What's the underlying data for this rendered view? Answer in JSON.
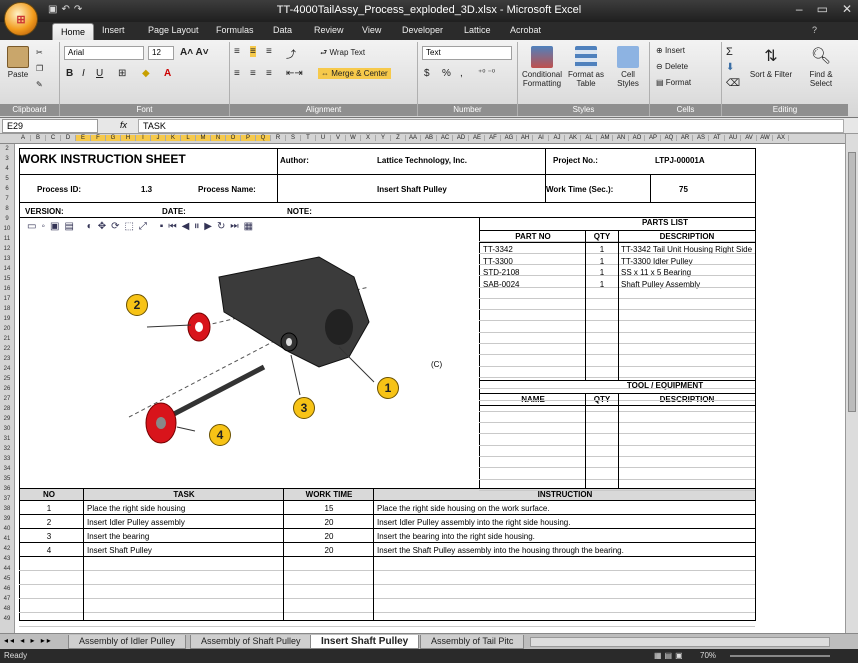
{
  "window": {
    "title": "TT-4000TailAssy_Process_exploded_3D.xlsx - Microsoft Excel"
  },
  "ribbon_tabs": [
    "Home",
    "Insert",
    "Page Layout",
    "Formulas",
    "Data",
    "Review",
    "View",
    "Developer",
    "Lattice",
    "Acrobat"
  ],
  "ribbon": {
    "paste": "Paste",
    "clipboard": "Clipboard",
    "font_name": "Arial",
    "font_size": "12",
    "font": "Font",
    "wrap_text": "Wrap Text",
    "merge_center": "Merge & Center",
    "alignment": "Alignment",
    "number_format": "Text",
    "number": "Number",
    "currency": "$",
    "percent": "%",
    "comma": ",",
    "conditional": "Conditional Formatting",
    "format_table": "Format as Table",
    "cell_styles": "Cell Styles",
    "styles": "Styles",
    "insert": "Insert",
    "delete": "Delete",
    "format": "Format",
    "cells": "Cells",
    "sort_filter": "Sort & Filter",
    "find_select": "Find & Select",
    "editing": "Editing"
  },
  "formula_bar": {
    "name_box": "E29",
    "fx": "fx",
    "value": "TASK"
  },
  "sheet": {
    "title": "WORK INSTRUCTION SHEET",
    "author_label": "Author:",
    "author": "Lattice Technology, Inc.",
    "project_label": "Project No.:",
    "project": "LTPJ-00001A",
    "process_id_label": "Process ID:",
    "process_id": "1.3",
    "process_name_label": "Process Name:",
    "process_name": "Insert Shaft Pulley",
    "work_time_label": "Work Time (Sec.):",
    "work_time": "75",
    "version_label": "VERSION:",
    "date_label": "DATE:",
    "note_label": "NOTE:"
  },
  "parts_list": {
    "title": "PARTS LIST",
    "headers": [
      "PART NO",
      "QTY",
      "DESCRIPTION"
    ],
    "rows": [
      [
        "TT-3342",
        "1",
        "TT-3342 Tail Unit Housing Right Side"
      ],
      [
        "TT-3300",
        "1",
        "TT-3300 Idler Pulley"
      ],
      [
        "STD-2108",
        "1",
        "SS x 11 x 5 Bearing"
      ],
      [
        "SAB-0024",
        "1",
        "Shaft Pulley Assembly"
      ]
    ]
  },
  "tools": {
    "title": "TOOL / EQUIPMENT",
    "headers": [
      "NAME",
      "QTY",
      "DESCRIPTION"
    ]
  },
  "view3d": {
    "callouts": [
      "2",
      "1",
      "3",
      "4"
    ],
    "label": "(C)"
  },
  "tasks": {
    "headers": [
      "NO",
      "TASK",
      "WORK TIME",
      "INSTRUCTION"
    ],
    "rows": [
      [
        "1",
        "Place the right side housing",
        "15",
        "Place the right side housing on the work surface."
      ],
      [
        "2",
        "Insert Idler Pulley assembly",
        "20",
        "Insert Idler Pulley assembly into the right side housing."
      ],
      [
        "3",
        "Insert the bearing",
        "20",
        "Insert the bearing into the right side housing."
      ],
      [
        "4",
        "Insert Shaft Pulley",
        "20",
        "Insert the Shaft Pulley assembly into the housing through the bearing."
      ]
    ]
  },
  "sheet_tabs": [
    "Assembly of Idler Pulley",
    "Assembly of Shaft Pulley",
    "Insert Shaft Pulley",
    "Assembly of Tail Pitc"
  ],
  "status": {
    "ready": "Ready",
    "zoom": "70%"
  }
}
